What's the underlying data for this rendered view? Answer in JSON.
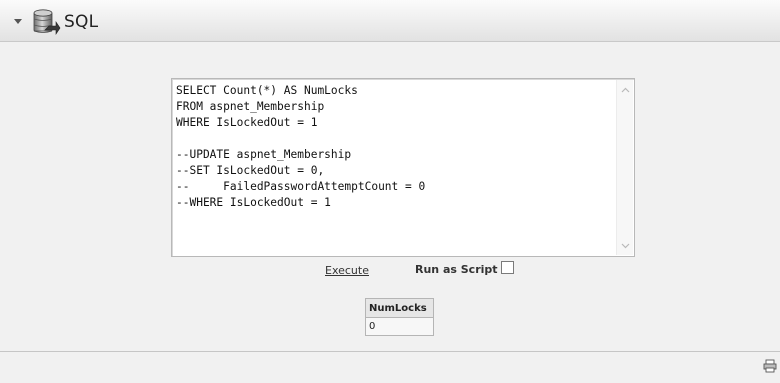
{
  "panel": {
    "title": "SQL"
  },
  "editor": {
    "query": "SELECT Count(*) AS NumLocks\nFROM aspnet_Membership\nWHERE IsLockedOut = 1\n\n--UPDATE aspnet_Membership\n--SET IsLockedOut = 0,\n--     FailedPasswordAttemptCount = 0\n--WHERE IsLockedOut = 1"
  },
  "actions": {
    "execute_label": "Execute",
    "run_as_script_label": "Run as Script",
    "run_as_script_checked": false
  },
  "results": {
    "columns": [
      "NumLocks"
    ],
    "rows": [
      [
        "0"
      ]
    ]
  },
  "icons": {
    "collapse": "chevron-down-icon",
    "database": "database-icon",
    "print": "print-icon"
  }
}
